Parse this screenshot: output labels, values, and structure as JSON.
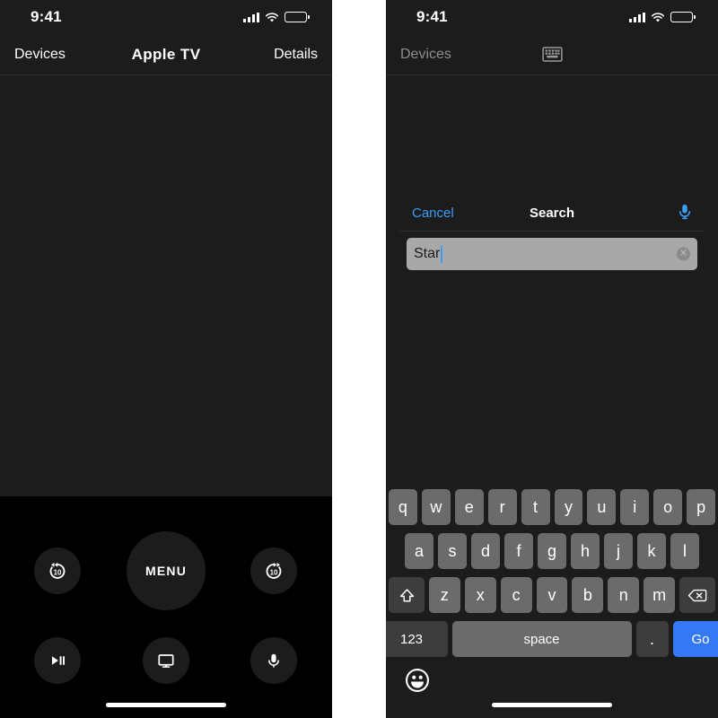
{
  "left_phone": {
    "status_bar": {
      "time": "9:41",
      "signal_icon": "cellular-signal-icon",
      "wifi_icon": "wifi-icon",
      "battery_icon": "battery-full-icon"
    },
    "nav": {
      "back_label": "Devices",
      "title": "Apple  TV",
      "right_label": "Details"
    },
    "remote": {
      "skip_back_label": "10",
      "skip_forward_label": "10",
      "menu_label": "MENU",
      "skip_back_icon": "skip-back-10-icon",
      "skip_forward_icon": "skip-forward-10-icon",
      "play_pause_icon": "play-pause-icon",
      "tv_icon": "tv-icon",
      "mic_icon": "microphone-icon"
    }
  },
  "right_phone": {
    "status_bar": {
      "time": "9:41",
      "signal_icon": "cellular-signal-icon",
      "wifi_icon": "wifi-icon",
      "battery_icon": "battery-full-icon"
    },
    "nav": {
      "back_label": "Devices",
      "keyboard_icon": "keyboard-icon"
    },
    "search": {
      "cancel_label": "Cancel",
      "title": "Search",
      "dictation_icon": "microphone-icon",
      "field_value": "Star",
      "clear_icon": "clear-text-icon"
    },
    "keyboard": {
      "row1": [
        "q",
        "w",
        "e",
        "r",
        "t",
        "y",
        "u",
        "i",
        "o",
        "p"
      ],
      "row2": [
        "a",
        "s",
        "d",
        "f",
        "g",
        "h",
        "j",
        "k",
        "l"
      ],
      "row3": [
        "z",
        "x",
        "c",
        "v",
        "b",
        "n",
        "m"
      ],
      "shift_icon": "shift-icon",
      "backspace_icon": "backspace-icon",
      "numbers_label": "123",
      "space_label": "space",
      "period_label": ".",
      "go_label": "Go",
      "emoji_icon": "emoji-icon"
    }
  },
  "colors": {
    "accent_blue": "#3478f6",
    "link_blue": "#3b9df8",
    "key_gray": "#6b6b6b",
    "panel_dark": "#1c1c1c"
  }
}
